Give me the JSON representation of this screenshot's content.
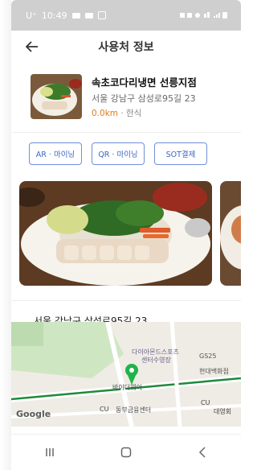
{
  "status_bar": {
    "carrier": "U⁺",
    "time": "10:49"
  },
  "appbar": {
    "title": "사용처 정보"
  },
  "store": {
    "name": "속초코다리냉면 선릉지점",
    "address": "서울 강남구 삼성로95길 23",
    "distance": "0.0km",
    "separator": "·",
    "category": "한식"
  },
  "buttons": [
    {
      "label": "AR · 마이닝"
    },
    {
      "label": "QR · 마이닝"
    },
    {
      "label": "SOT결제"
    }
  ],
  "address_detail": "서울 강남구 삼성로95길 23",
  "map": {
    "labels": [
      "다이아몬드스포츠",
      "센터수영장",
      "GS25",
      "현대백화점",
      "바이더웨이",
      "CU",
      "동부금융센터",
      "대영회",
      "CU",
      "Google"
    ]
  },
  "colors": {
    "accent": "#3e64c7",
    "distance": "#e07b1a",
    "status_bar": "#cfcfcf"
  }
}
